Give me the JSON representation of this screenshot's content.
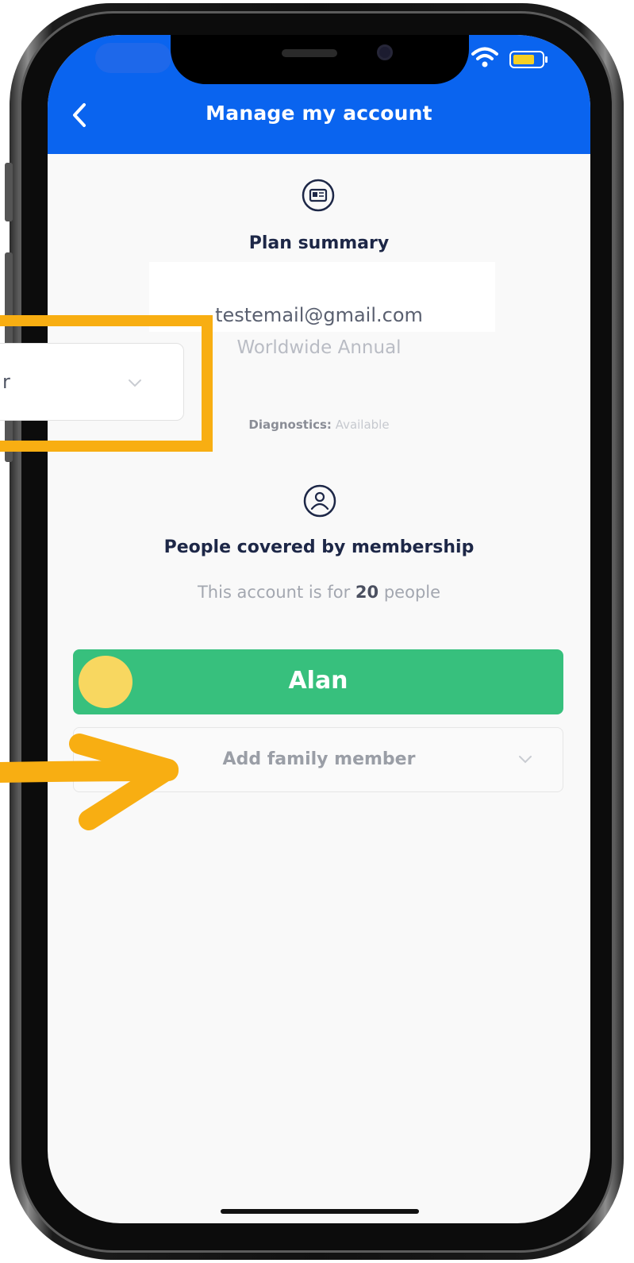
{
  "header": {
    "title": "Manage my account"
  },
  "plan_summary": {
    "title": "Plan summary",
    "email": "testemail@gmail.com",
    "plan_name": "Worldwide Annual",
    "diagnostics_label": "Diagnostics:",
    "diagnostics_value": "Available"
  },
  "people": {
    "title": "People covered by membership",
    "coverage_prefix": "This account is for",
    "coverage_count": "20",
    "coverage_suffix": "people",
    "members": [
      {
        "name": "Alan",
        "card_color": "#37c07d",
        "avatar_color": "#f8d760"
      }
    ],
    "add_member_label": "Add family member"
  },
  "overlay": {
    "partial_dropdown_text": "r",
    "highlight_color": "#f8ae12"
  },
  "icons": {
    "back": "chevron-left-icon",
    "plan": "id-card-icon",
    "person": "person-circle-icon",
    "wifi": "wifi-icon",
    "battery": "battery-icon",
    "dropdown": "chevron-down-icon"
  },
  "colors": {
    "header_blue": "#0a64ef",
    "member_green": "#37c07d",
    "text_navy": "#1d2747"
  }
}
